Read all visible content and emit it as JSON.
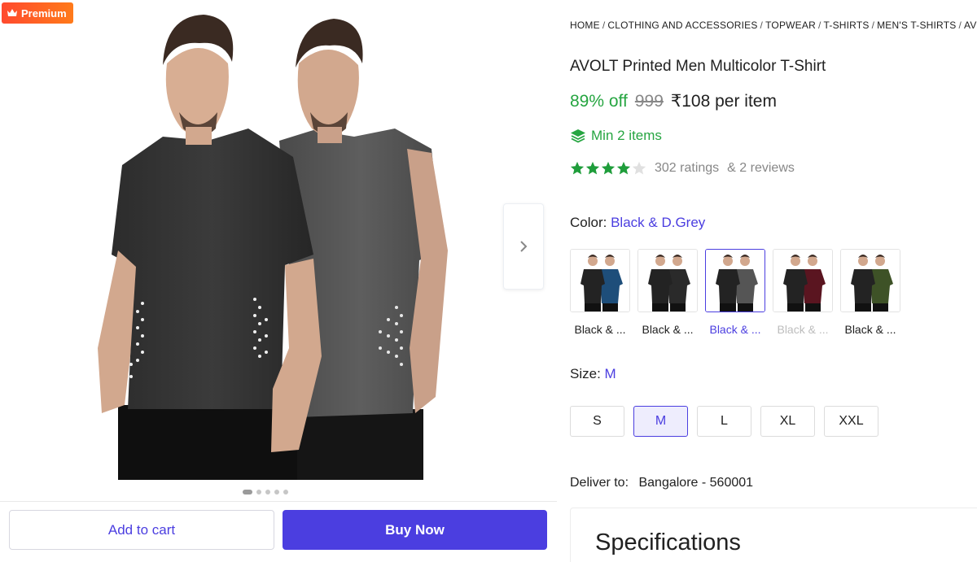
{
  "badge": {
    "label": "Premium"
  },
  "gallery": {
    "dots": 5,
    "active_dot": 0
  },
  "actions": {
    "add_to_cart": "Add to cart",
    "buy_now": "Buy Now"
  },
  "breadcrumb": [
    "HOME",
    "CLOTHING AND ACCESSORIES",
    "TOPWEAR",
    "T-SHIRTS",
    "MEN'S T-SHIRTS",
    "AVO"
  ],
  "product": {
    "title": "AVOLT Printed Men Multicolor T-Shirt",
    "discount": "89% off",
    "mrp": "999",
    "price": "₹108 per item",
    "min_items": "Min 2 items",
    "rating_stars": 4,
    "ratings_count": "302 ratings",
    "reviews_count": "& 2 reviews"
  },
  "color": {
    "label": "Color:",
    "selected": "Black & D.Grey",
    "options": [
      {
        "label": "Black & ...",
        "second": "#1e4e7a",
        "state": "default"
      },
      {
        "label": "Black & ...",
        "second": "#2a2a2a",
        "state": "default"
      },
      {
        "label": "Black & ...",
        "second": "#555555",
        "state": "selected"
      },
      {
        "label": "Black & ...",
        "second": "#5a1520",
        "state": "unavailable"
      },
      {
        "label": "Black & ...",
        "second": "#3e5227",
        "state": "default"
      }
    ]
  },
  "size": {
    "label": "Size:",
    "selected": "M",
    "options": [
      "S",
      "M",
      "L",
      "XL",
      "XXL"
    ]
  },
  "delivery": {
    "label": "Deliver to:",
    "location": "Bangalore - 560001"
  },
  "specs": {
    "title": "Specifications"
  },
  "colors": {
    "accent": "#4b3ee0",
    "green": "#26a541",
    "star": "#1f9d3b"
  },
  "icons": {
    "badge": "crown-icon",
    "next": "chevron-right-icon",
    "min_items": "layers-icon",
    "rating": "star-icon"
  }
}
